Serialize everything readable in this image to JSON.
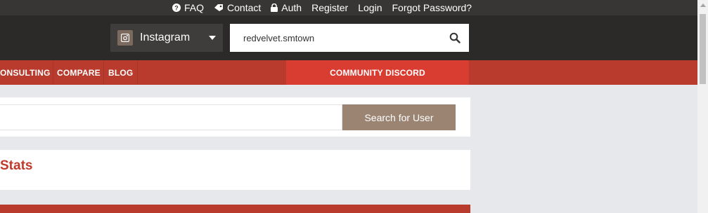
{
  "top_links": [
    {
      "icon": "help-icon",
      "label": "FAQ"
    },
    {
      "icon": "tag-icon",
      "label": "Contact"
    },
    {
      "icon": "lock-icon",
      "label": "Auth"
    },
    {
      "icon": "",
      "label": "Register"
    },
    {
      "icon": "",
      "label": "Login"
    },
    {
      "icon": "",
      "label": "Forgot Password?"
    }
  ],
  "platform_select": {
    "icon": "instagram-icon",
    "selected": "Instagram"
  },
  "search": {
    "value": "redvelvet.smtown",
    "icon": "search-icon"
  },
  "nav": {
    "items": [
      "ONSULTING",
      "COMPARE",
      "BLOG"
    ],
    "highlight": "COMMUNITY DISCORD"
  },
  "user_search": {
    "value": "",
    "button_label": "Search for User"
  },
  "section": {
    "title": "Stats"
  },
  "colors": {
    "brand_red": "#b93b2e",
    "discord_red": "#d93d31",
    "button_brown": "#9c8473",
    "header_dark": "#2b2a28"
  }
}
